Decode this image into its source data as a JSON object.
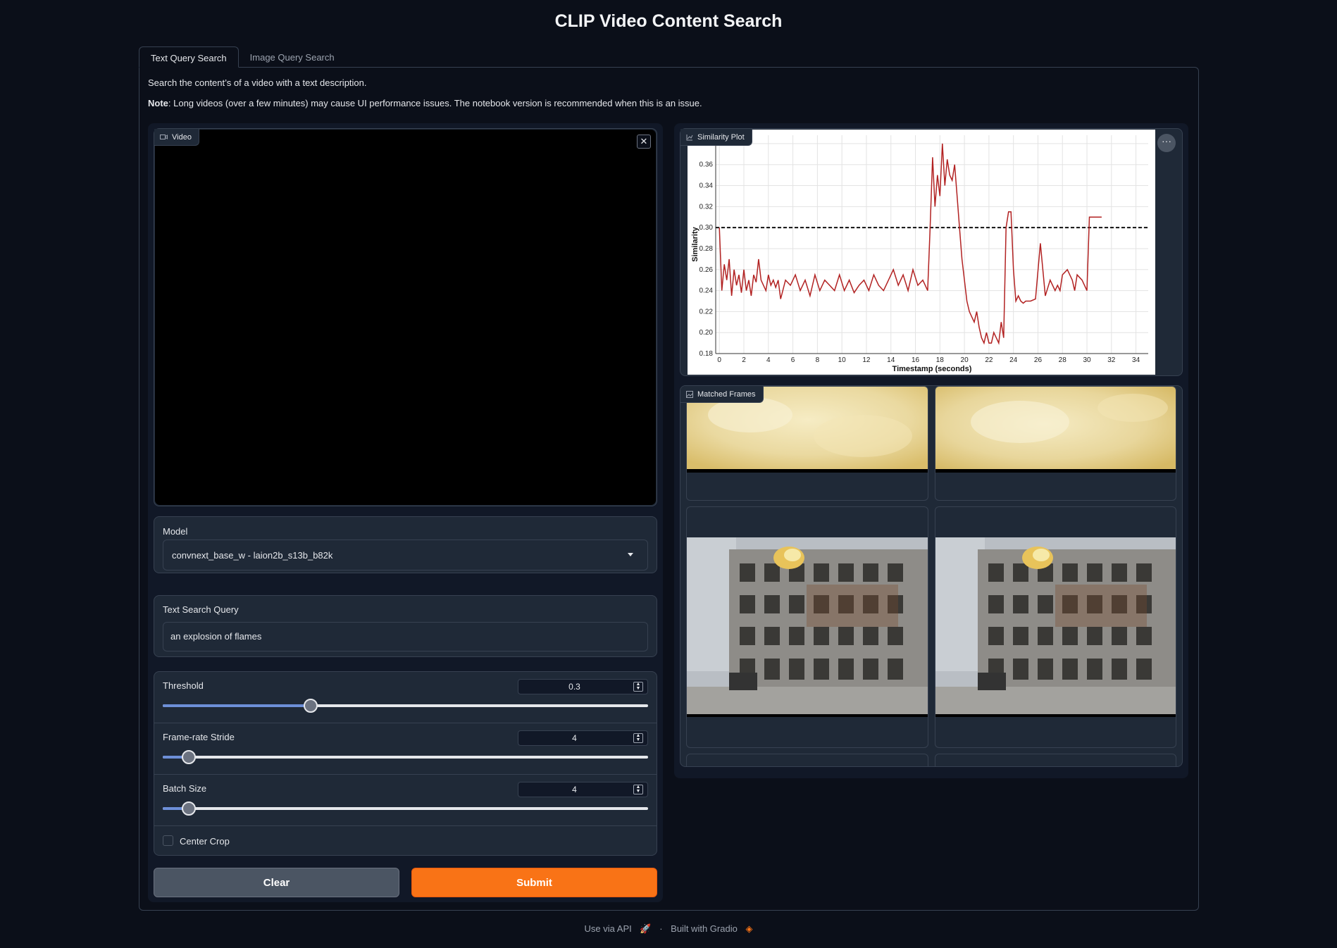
{
  "app": {
    "title": "CLIP Video Content Search"
  },
  "tabs": [
    {
      "label": "Text Query Search",
      "active": true
    },
    {
      "label": "Image Query Search",
      "active": false
    }
  ],
  "description": "Search the content’s of a video with a text description.",
  "note": {
    "bold": "Note",
    "text": ": Long videos (over a few minutes) may cause UI performance issues. The notebook version is recommended when this is an issue."
  },
  "video": {
    "label": "Video",
    "icon": "video-camera-icon"
  },
  "model": {
    "label": "Model",
    "value": "convnext_base_w - laion2b_s13b_b82k"
  },
  "text_query": {
    "label": "Text Search Query",
    "value": "an explosion of flames"
  },
  "sliders": [
    {
      "label": "Threshold",
      "value": "0.3",
      "fraction": 0.3
    },
    {
      "label": "Frame-rate Stride",
      "value": "4",
      "fraction": 0.053
    },
    {
      "label": "Batch Size",
      "value": "4",
      "fraction": 0.053
    }
  ],
  "center_crop": {
    "label": "Center Crop",
    "checked": false
  },
  "buttons": {
    "clear": "Clear",
    "submit": "Submit"
  },
  "plot": {
    "label": "Similarity Plot",
    "icon": "chart-icon"
  },
  "gallery": {
    "label": "Matched Frames",
    "icon": "image-icon"
  },
  "footer": {
    "api": "Use via API",
    "separator": "·",
    "built": "Built with Gradio"
  },
  "colors": {
    "accent": "#f97316",
    "background": "#0b0f19",
    "line": "#b22222",
    "slider_fill": "#6d8fd8"
  },
  "chart_data": {
    "type": "line",
    "title": "",
    "xlabel": "Timestamp (seconds)",
    "ylabel": "Similarity",
    "xlim": [
      -0.3,
      35
    ],
    "ylim": [
      0.18,
      0.388
    ],
    "xticks": [
      0,
      2,
      4,
      6,
      8,
      10,
      12,
      14,
      16,
      18,
      20,
      22,
      24,
      26,
      28,
      30,
      32,
      34
    ],
    "yticks": [
      0.18,
      0.2,
      0.22,
      0.24,
      0.26,
      0.28,
      0.3,
      0.32,
      0.34,
      0.36,
      0.38
    ],
    "threshold": 0.3,
    "grid": true,
    "series": [
      {
        "x": [
          0,
          0.2,
          0.4,
          0.6,
          0.8,
          1.0,
          1.2,
          1.4,
          1.6,
          1.8,
          2.0,
          2.2,
          2.4,
          2.6,
          2.8,
          3.0,
          3.2,
          3.4,
          3.6,
          3.8,
          4.0,
          4.2,
          4.4,
          4.6,
          4.8,
          5.0,
          5.4,
          5.8,
          6.2,
          6.6,
          7.0,
          7.4,
          7.8,
          8.2,
          8.6,
          9.0,
          9.4,
          9.8,
          10.2,
          10.6,
          11.0,
          11.4,
          11.8,
          12.2,
          12.6,
          13.0,
          13.4,
          13.8,
          14.2,
          14.6,
          15.0,
          15.4,
          15.8,
          16.2,
          16.6,
          17.0,
          17.2,
          17.4,
          17.6,
          17.8,
          18.0,
          18.2,
          18.4,
          18.6,
          18.8,
          19.0,
          19.2,
          19.4,
          19.6,
          19.8,
          20.0,
          20.2,
          20.4,
          20.6,
          20.8,
          21.0,
          21.2,
          21.4,
          21.6,
          21.8,
          22.0,
          22.2,
          22.4,
          22.6,
          22.8,
          23.0,
          23.2,
          23.4,
          23.6,
          23.8,
          24.0,
          24.2,
          24.4,
          24.6,
          24.8,
          25.0,
          25.4,
          25.8,
          26.2,
          26.6,
          27.0,
          27.4,
          27.6,
          27.8,
          28.0,
          28.4,
          28.8,
          29.0,
          29.2,
          29.6,
          30.0,
          30.2,
          30.4,
          30.6,
          30.8,
          31.2
        ],
        "y": [
          0.3,
          0.24,
          0.265,
          0.25,
          0.27,
          0.235,
          0.26,
          0.245,
          0.255,
          0.238,
          0.26,
          0.24,
          0.25,
          0.235,
          0.255,
          0.248,
          0.27,
          0.25,
          0.245,
          0.24,
          0.255,
          0.245,
          0.25,
          0.243,
          0.25,
          0.232,
          0.25,
          0.245,
          0.255,
          0.24,
          0.25,
          0.235,
          0.255,
          0.24,
          0.25,
          0.245,
          0.24,
          0.255,
          0.24,
          0.25,
          0.238,
          0.245,
          0.25,
          0.24,
          0.255,
          0.245,
          0.24,
          0.25,
          0.26,
          0.245,
          0.255,
          0.24,
          0.26,
          0.245,
          0.25,
          0.24,
          0.3,
          0.367,
          0.32,
          0.35,
          0.33,
          0.38,
          0.34,
          0.365,
          0.35,
          0.345,
          0.36,
          0.33,
          0.3,
          0.27,
          0.25,
          0.23,
          0.22,
          0.215,
          0.21,
          0.22,
          0.205,
          0.195,
          0.19,
          0.2,
          0.19,
          0.19,
          0.2,
          0.195,
          0.19,
          0.21,
          0.195,
          0.3,
          0.315,
          0.315,
          0.26,
          0.23,
          0.235,
          0.23,
          0.228,
          0.23,
          0.23,
          0.232,
          0.285,
          0.235,
          0.25,
          0.24,
          0.245,
          0.24,
          0.255,
          0.26,
          0.25,
          0.24,
          0.255,
          0.25,
          0.24,
          0.31,
          0.31,
          0.31,
          0.31,
          0.31
        ]
      }
    ]
  }
}
